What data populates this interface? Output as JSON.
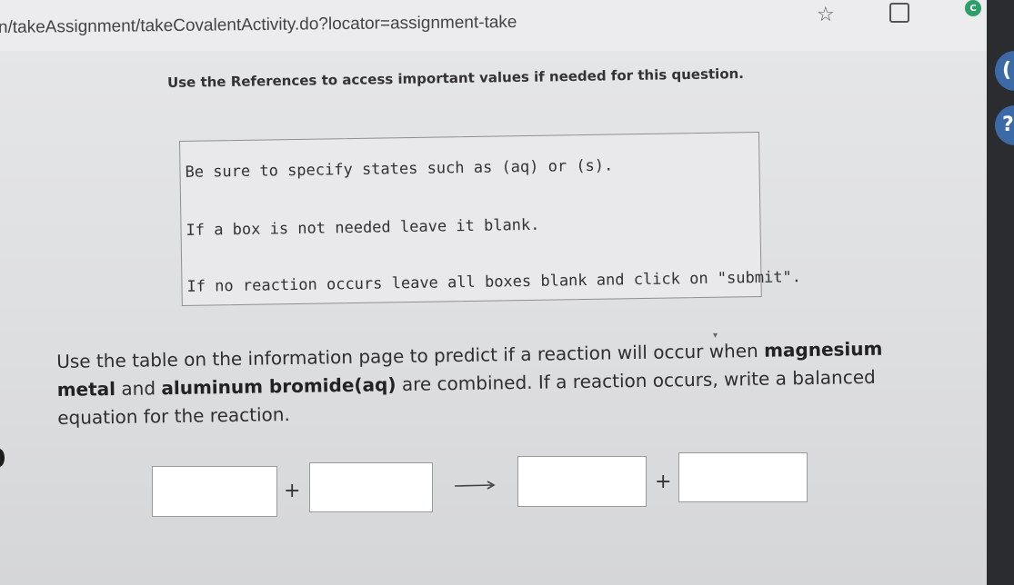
{
  "browser": {
    "url": "n/takeAssignment/takeCovalentActivity.do?locator=assignment-take",
    "profile_initial": "C"
  },
  "page": {
    "references_note": "Use the References to access important values if needed for this question.",
    "instructions": [
      "Be sure to specify states such as (aq) or (s).",
      "If a box is not needed leave it blank.",
      "If no reaction occurs leave all boxes blank and click on \"submit\"."
    ],
    "question": {
      "part1": "Use the table on the information page to predict if a reaction will occur when ",
      "bold1": "magnesium metal",
      "part2": " and ",
      "bold2": "aluminum bromide(aq)",
      "part3": " are combined. If a reaction occurs, write a balanced equation for the reaction."
    },
    "equation": {
      "plus": "+",
      "reactant1": "",
      "reactant2": "",
      "product1": "",
      "product2": ""
    }
  },
  "sidebar": {
    "help_symbol": "?"
  }
}
